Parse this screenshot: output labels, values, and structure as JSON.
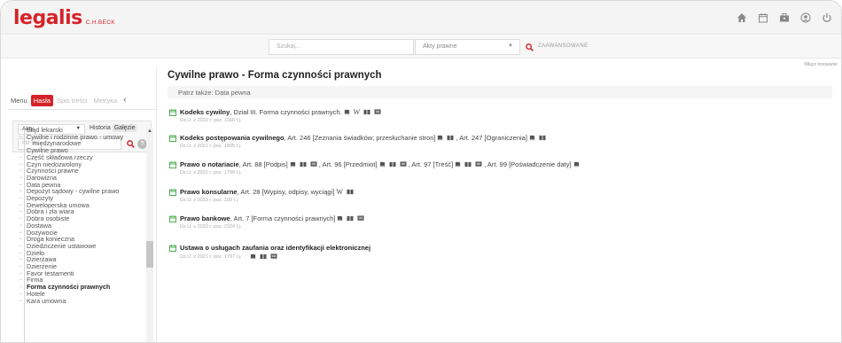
{
  "header": {
    "logo_word": "legalis",
    "logo_sub": "C.H.BECK",
    "icons": [
      "home-icon",
      "calendar-icon",
      "briefcase-icon",
      "user-icon",
      "power-icon"
    ]
  },
  "search": {
    "placeholder": "Szukaj...",
    "select_value": "Akty prawne",
    "advanced_label": "ZAAWANSOWANE"
  },
  "sidebar": {
    "tabs": [
      {
        "label": "Menu",
        "state": "normal"
      },
      {
        "label": "Hasła",
        "state": "active"
      },
      {
        "label": "Spis treści",
        "state": "disabled"
      },
      {
        "label": "Metryka",
        "state": "disabled"
      }
    ],
    "filter": {
      "select_value": "Akty",
      "tab_historia": "Historia",
      "tab_galezie": "Gałęzie",
      "search_placeholder": "Idź do..."
    },
    "tree": [
      "Błąd lekarski",
      "Cywilne i rodzinne prawo - umowy",
      "międzynarodowe",
      "Cywilne prawo",
      "Część składowa rzeczy",
      "Czyn niedozwolony",
      "Czynności prawne",
      "Darowizna",
      "Data pewna",
      "Depozyt sądowy - cywilne prawo",
      "Depozyty",
      "Deweloperska umowa",
      "Dobra i zła wiara",
      "Dobra osobiste",
      "Dostawa",
      "Dożywocie",
      "Droga konieczna",
      "Dziedziczenie ustawowe",
      "Dzieło",
      "Dzierżawa",
      "Dzierżenie",
      "Favor testamenti",
      "Firma",
      "Forma czynności prawnych",
      "Hotele",
      "Kara umowna"
    ]
  },
  "main": {
    "wlacz": "Włącz tonowanie",
    "title": "Cywilne prawo - Forma czynności prawnych",
    "patrz": "Patrz także: Data pewna",
    "entries": [
      {
        "name": "Kodeks cywilny",
        "rest": ", Dział III. Forma czynności prawnych.",
        "sub": "Dz.U. z 2022 r. poz. 1360 t.j."
      },
      {
        "name": "Kodeks postępowania cywilnego",
        "rest": ", Art. 246 [Zeznania świadków; przesłuchanie stron]",
        "rest2": ", Art. 247 [Ograniczenia]",
        "sub": "Dz.U. z 2021 r. poz. 1805 t.j."
      },
      {
        "name": "Prawo o notariacie",
        "rest": ", Art. 88 [Podpis]",
        "rest2": ", Art. 96 [Przedmiot]",
        "rest3": ", Art. 97 [Treść]",
        "rest4": ", Art. 99 [Poświadczenie daty]",
        "sub": "Dz.U. z 2022 r. poz. 1799 t.j."
      },
      {
        "name": "Prawo konsularne",
        "rest": ", Art. 28 [Wypisy, odpisy, wyciągi]",
        "sub": "Dz.U. z 2023 r. poz. 199 t.j."
      },
      {
        "name": "Prawo bankowe",
        "rest": ", Art. 7 [Forma czynności prawnych]",
        "sub": "Dz.U. z 2022 r. poz. 2324 t.j."
      },
      {
        "name": "Ustawa o usługach zaufania oraz identyfikacji elektronicznej",
        "rest": "",
        "sub": "Dz.U. z 2021 r. poz. 1797 t.j."
      }
    ],
    "w_label": "W"
  },
  "colors": {
    "brand": "#d52329",
    "calendar": "#4caf50"
  }
}
